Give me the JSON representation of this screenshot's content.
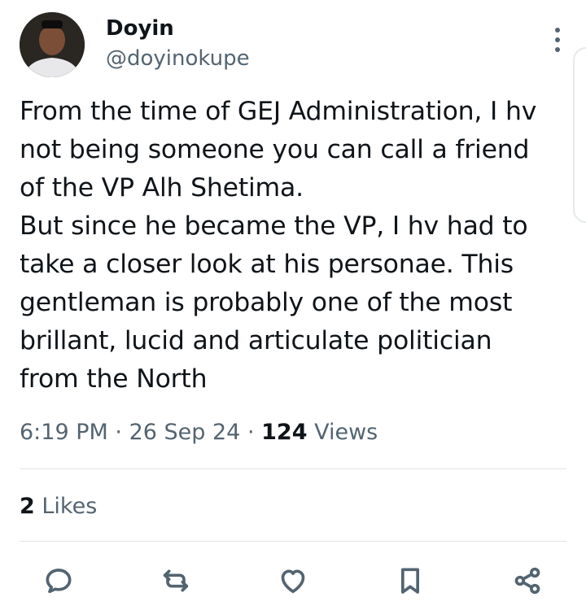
{
  "author": {
    "name": "Doyin",
    "handle": "@doyinokupe"
  },
  "tweet": {
    "text": "From the time of GEJ Administration, I hv\nnot being someone you can call a friend\nof the VP Alh Shetima.\nBut since he became the VP, I hv had to\ntake a closer look at his personae. This\ngentleman is probably one of the most\nbrillant, lucid and articulate politician\nfrom the North"
  },
  "meta": {
    "time": "6:19 PM",
    "sep1": "·",
    "date": "26 Sep 24",
    "sep2": "·",
    "views_count": "124",
    "views_label": "Views"
  },
  "stats": {
    "likes_count": "2",
    "likes_label": "Likes"
  },
  "icons": {
    "more": "more-vertical-icon",
    "reply": "reply-icon",
    "retweet": "retweet-icon",
    "like": "heart-icon",
    "bookmark": "bookmark-icon",
    "share": "share-icon"
  },
  "colors": {
    "text": "#0f1419",
    "secondary": "#536471",
    "divider": "#dfe3e6"
  }
}
